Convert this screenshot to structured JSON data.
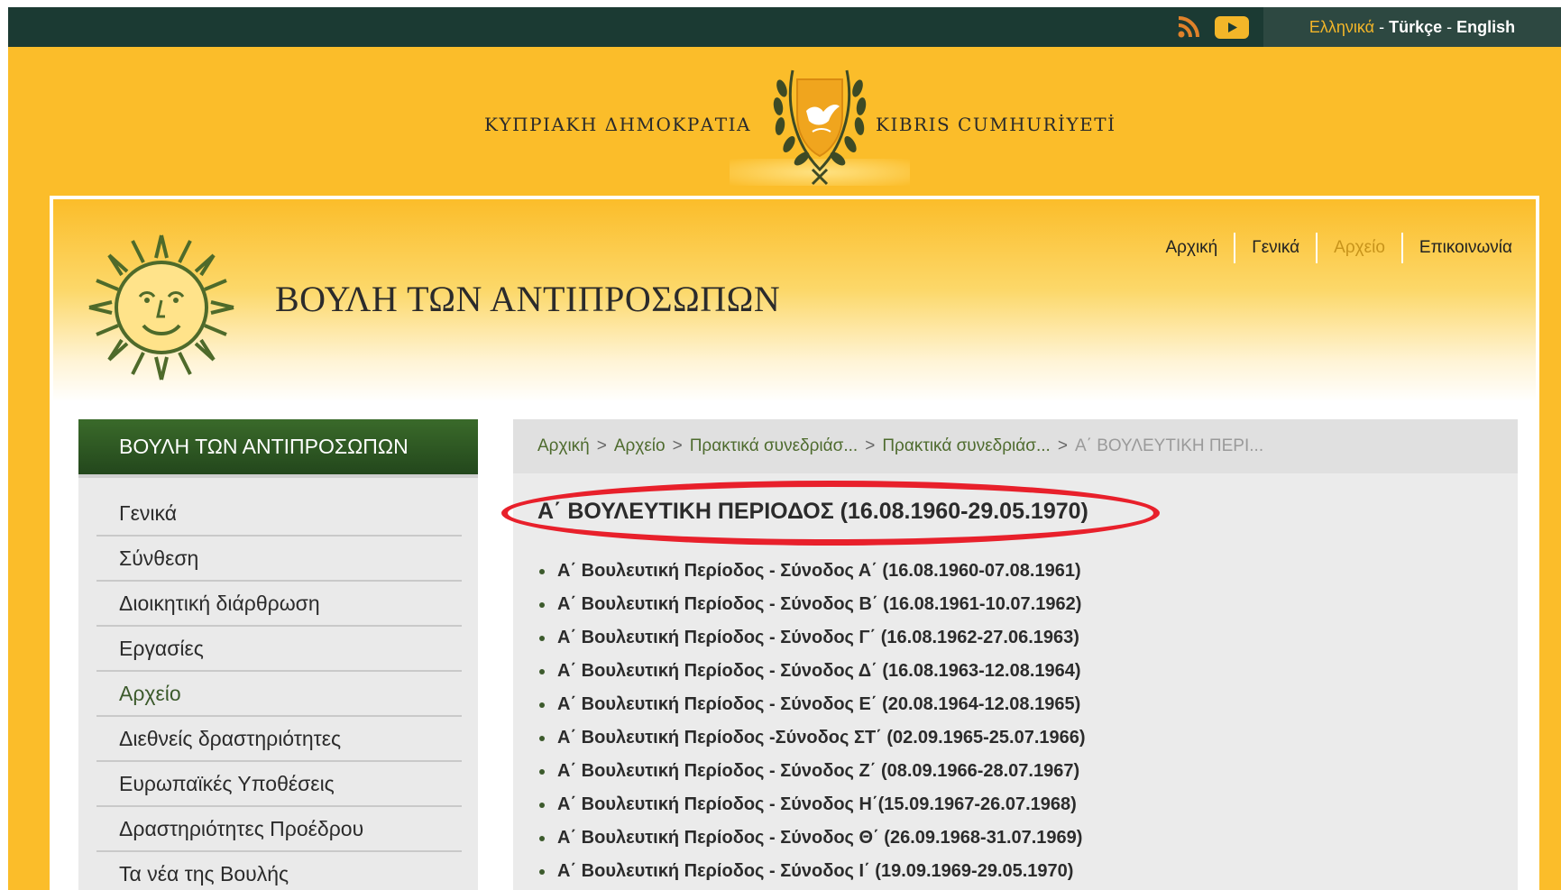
{
  "topbar": {
    "lang_greek": "Ελληνικά",
    "lang_turkish": "Türkçe",
    "lang_english": "English",
    "separator": "-",
    "icons": [
      "rss-icon",
      "youtube-icon"
    ]
  },
  "emblem": {
    "text_greek": "ΚΥΠΡΙΑΚΗ ΔΗΜΟΚΡΑΤΙΑ",
    "text_turkish": "KIBRIS CUMHURİYETİ"
  },
  "site": {
    "title": "ΒΟΥΛΗ ΤΩΝ ΑΝΤΙΠΡΟΣΩΠΩΝ"
  },
  "topnav": [
    "Αρχική",
    "Γενικά",
    "Αρχείο",
    "Επικοινωνία"
  ],
  "topnav_active": "Αρχείο",
  "sidebar": {
    "heading": "ΒΟΥΛΗ ΤΩΝ ΑΝΤΙΠΡΟΣΩΠΩΝ",
    "items": [
      "Γενικά",
      "Σύνθεση",
      "Διοικητική διάρθρωση",
      "Εργασίες",
      "Αρχείο",
      "Διεθνείς δραστηριότητες",
      "Ευρωπαϊκές Υποθέσεις",
      "Δραστηριότητες Προέδρου",
      "Τα νέα της Βουλής"
    ],
    "active": "Αρχείο"
  },
  "breadcrumb": {
    "items": [
      "Αρχική",
      "Αρχείο",
      "Πρακτικά συνεδριάσ...",
      "Πρακτικά συνεδριάσ..."
    ],
    "current": "Α΄ ΒΟΥΛΕΥΤΙΚΗ ΠΕΡΙ...",
    "separator": ">"
  },
  "page": {
    "title": "Α΄ ΒΟΥΛΕΥΤΙΚΗ ΠΕΡΙΟΔΟΣ (16.08.1960-29.05.1970)",
    "sessions": [
      "Α΄ Βουλευτική Περίοδος - Σύνοδος Α΄ (16.08.1960-07.08.1961)",
      "Α΄ Βουλευτική Περίοδος - Σύνοδος Β΄ (16.08.1961-10.07.1962)",
      "Α΄ Βουλευτική Περίοδος - Σύνοδος Γ΄ (16.08.1962-27.06.1963)",
      "Α΄ Βουλευτική Περίοδος - Σύνοδος Δ΄ (16.08.1963-12.08.1964)",
      "Α΄ Βουλευτική Περίοδος - Σύνοδος Ε΄ (20.08.1964-12.08.1965)",
      "Α΄ Βουλευτική Περίοδος -Σύνοδος ΣΤ΄ (02.09.1965-25.07.1966)",
      "Α΄ Βουλευτική Περίοδος - Σύνοδος Ζ΄ (08.09.1966-28.07.1967)",
      "Α΄ Βουλευτική Περίοδος - Σύνοδος Η΄(15.09.1967-26.07.1968)",
      "Α΄ Βουλευτική Περίοδος - Σύνοδος Θ΄ (26.09.1968-31.07.1969)",
      "Α΄ Βουλευτική Περίοδος - Σύνοδος Ι΄ (19.09.1969-29.05.1970)"
    ]
  },
  "colors": {
    "background_yellow": "#fbbd2a",
    "topbar": "#1b3a33",
    "sidebar_header": "#2f5a22",
    "highlight": "#e8202b",
    "accent": "#c8941b"
  }
}
